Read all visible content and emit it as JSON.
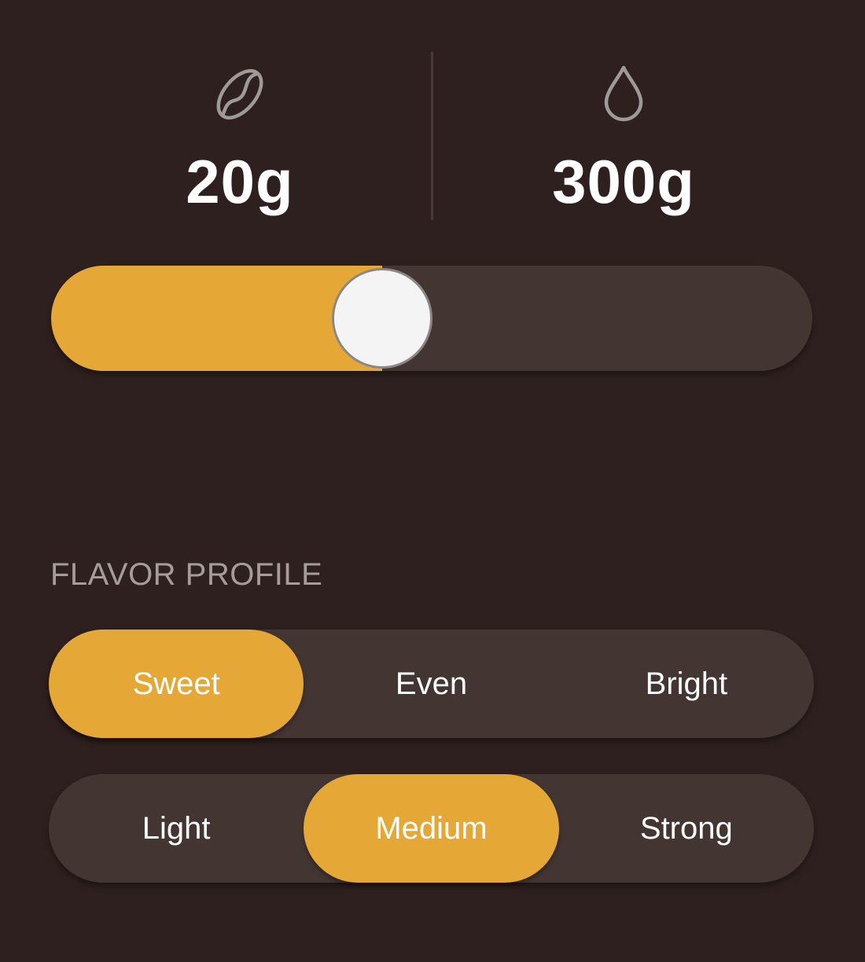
{
  "ratio": {
    "coffee": {
      "icon": "coffee-bean-icon",
      "value": "20g"
    },
    "water": {
      "icon": "water-drop-icon",
      "value": "300g"
    }
  },
  "slider": {
    "level": 0.435
  },
  "flavor_profile": {
    "label": "FLAVOR PROFILE",
    "options": [
      "Sweet",
      "Even",
      "Bright"
    ],
    "selected": "Sweet"
  },
  "strength": {
    "options": [
      "Light",
      "Medium",
      "Strong"
    ],
    "selected": "Medium"
  },
  "colors": {
    "background": "#2e201e",
    "accent": "#e5a735",
    "track": "#433532",
    "muted_text": "#a69d9b"
  }
}
